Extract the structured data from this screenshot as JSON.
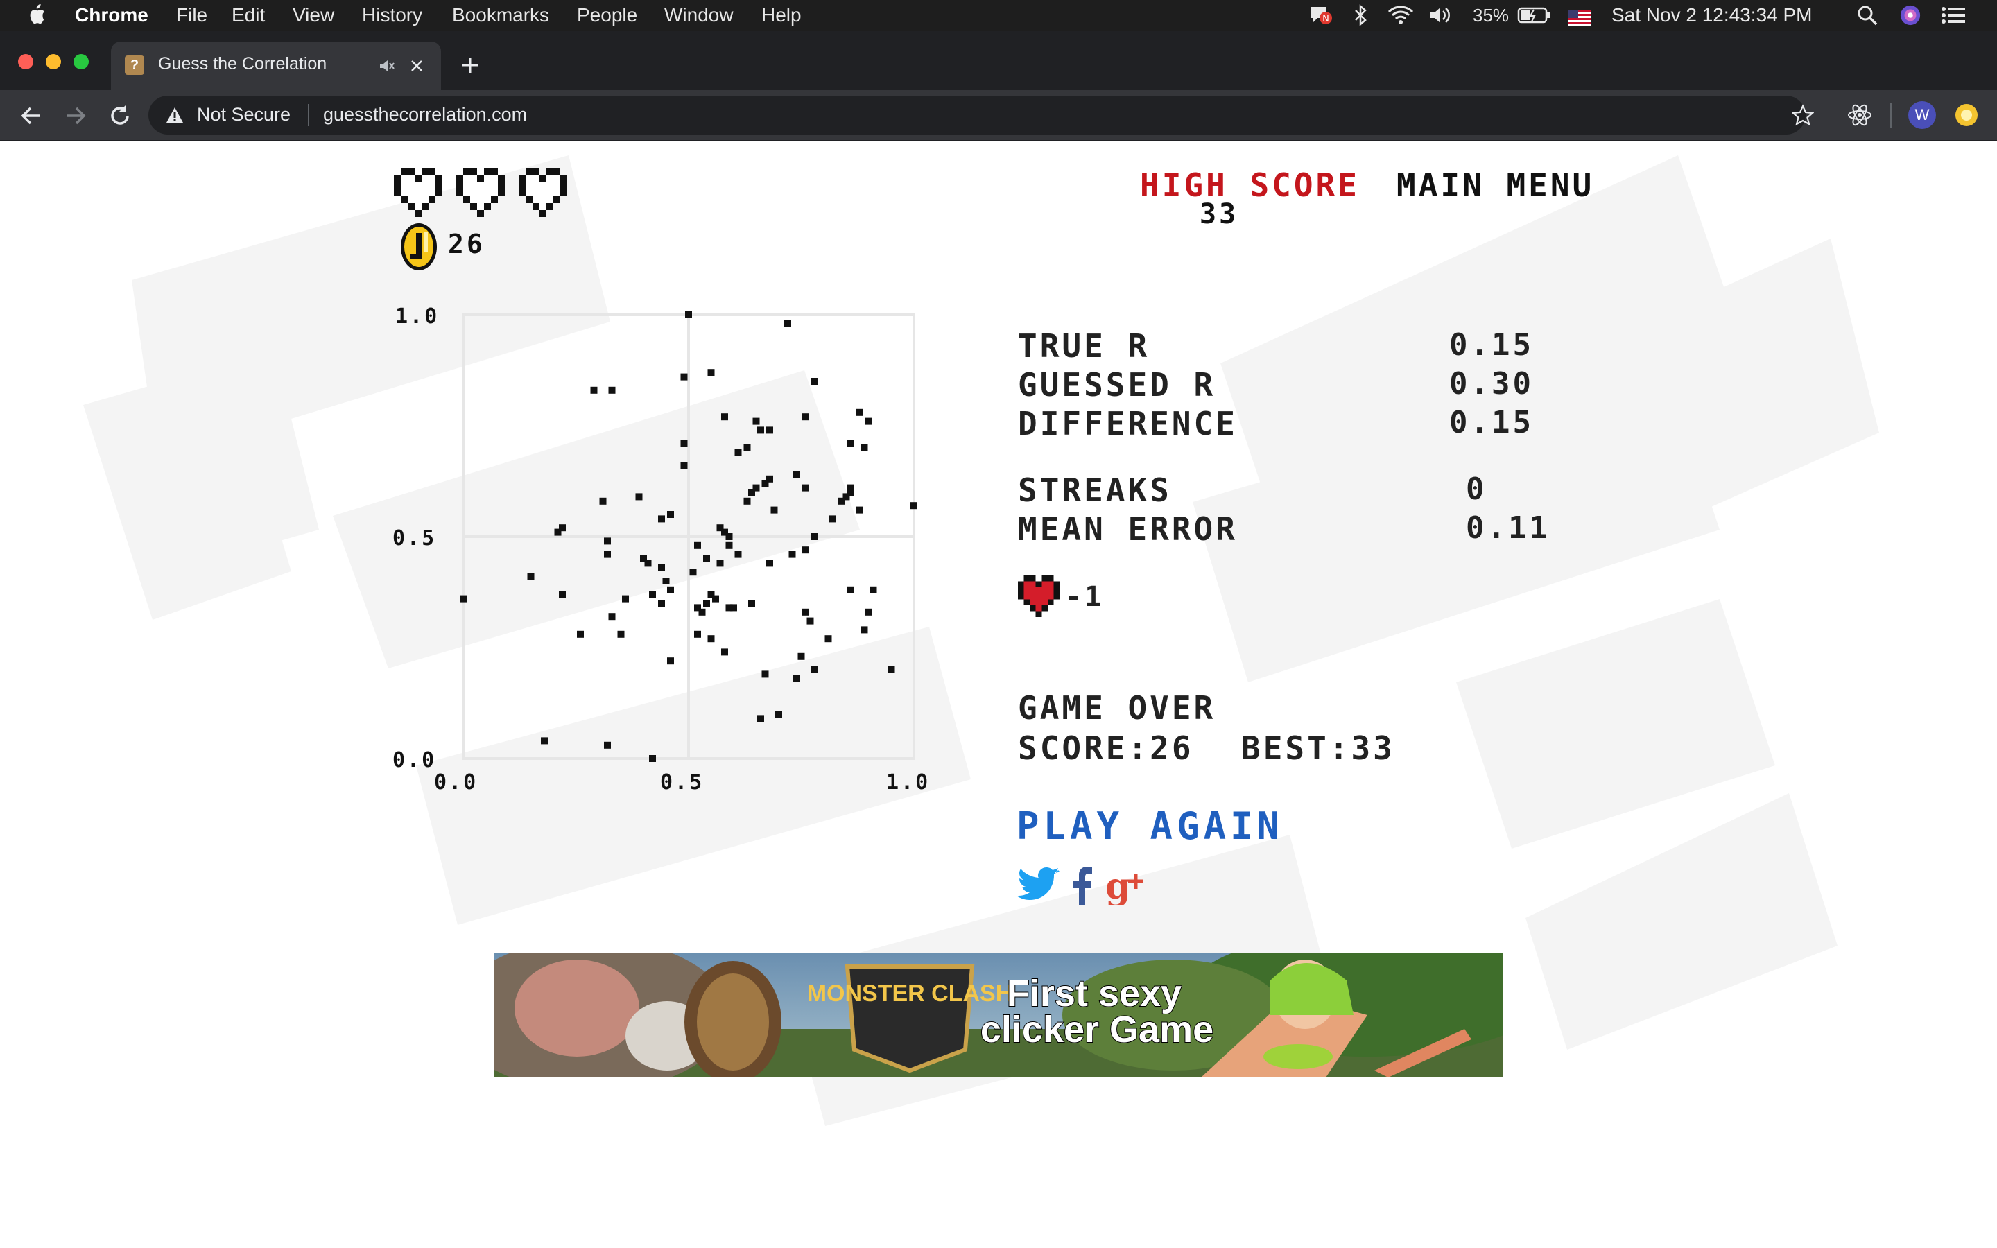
{
  "menubar": {
    "app_name": "Chrome",
    "items": [
      "File",
      "Edit",
      "View",
      "History",
      "Bookmarks",
      "People",
      "Window",
      "Help"
    ],
    "battery": "35%",
    "datetime": "Sat Nov 2  12:43:34 PM"
  },
  "browser": {
    "tab_title": "Guess the Correlation",
    "security_label": "Not Secure",
    "url": "guessthecorrelation.com",
    "profile_initial": "W"
  },
  "game": {
    "lives_remaining": 0,
    "lives_total": 3,
    "coins": "26",
    "high_score_label": "HIGH SCORE",
    "high_score_value": "33",
    "main_menu_label": "MAIN MENU",
    "stats": [
      {
        "label": "TRUE R",
        "value": "0.15"
      },
      {
        "label": "GUESSED R",
        "value": "0.30"
      },
      {
        "label": "DIFFERENCE",
        "value": "0.15"
      },
      {
        "label": "STREAKS",
        "value": "0"
      },
      {
        "label": "MEAN ERROR",
        "value": "0.11"
      }
    ],
    "life_change": "-1",
    "game_over_label": "GAME OVER",
    "score_label": "SCORE:26",
    "best_label": "BEST:33",
    "play_again_label": "PLAY AGAIN"
  },
  "colors": {
    "high_score_red": "#c4161c",
    "play_again_blue": "#1f5fbf",
    "twitter_blue": "#1da1f2",
    "facebook_blue": "#3b5998",
    "gplus_red": "#dd4b39",
    "heart_red": "#d41d2a",
    "coin_gold": "#f5c518"
  },
  "social": [
    "twitter-icon",
    "facebook-icon",
    "google-plus-icon"
  ],
  "ad": {
    "brand": "MONSTER CLASH",
    "line1": "First sexy",
    "line2": "clicker Game"
  },
  "chart_data": {
    "type": "scatter",
    "xlim": [
      0.0,
      1.0
    ],
    "ylim": [
      0.0,
      1.0
    ],
    "xticks": [
      "0.0",
      "0.5",
      "1.0"
    ],
    "yticks": [
      "0.0",
      "0.5",
      "1.0"
    ],
    "grid": true,
    "points": [
      [
        0.5,
        1.0
      ],
      [
        0.72,
        0.98
      ],
      [
        0.55,
        0.87
      ],
      [
        0.49,
        0.86
      ],
      [
        0.78,
        0.85
      ],
      [
        0.29,
        0.83
      ],
      [
        0.33,
        0.83
      ],
      [
        0.88,
        0.78
      ],
      [
        0.58,
        0.77
      ],
      [
        0.76,
        0.77
      ],
      [
        0.65,
        0.76
      ],
      [
        0.9,
        0.76
      ],
      [
        0.68,
        0.74
      ],
      [
        0.66,
        0.74
      ],
      [
        0.49,
        0.71
      ],
      [
        0.86,
        0.71
      ],
      [
        0.89,
        0.7
      ],
      [
        0.63,
        0.7
      ],
      [
        0.61,
        0.69
      ],
      [
        0.49,
        0.66
      ],
      [
        0.74,
        0.64
      ],
      [
        0.68,
        0.63
      ],
      [
        0.67,
        0.62
      ],
      [
        0.65,
        0.61
      ],
      [
        0.76,
        0.61
      ],
      [
        0.86,
        0.61
      ],
      [
        0.64,
        0.6
      ],
      [
        0.86,
        0.6
      ],
      [
        0.31,
        0.58
      ],
      [
        0.39,
        0.59
      ],
      [
        0.85,
        0.59
      ],
      [
        0.63,
        0.58
      ],
      [
        0.84,
        0.58
      ],
      [
        0.69,
        0.56
      ],
      [
        0.88,
        0.56
      ],
      [
        1.0,
        0.57
      ],
      [
        0.46,
        0.55
      ],
      [
        0.44,
        0.54
      ],
      [
        0.82,
        0.54
      ],
      [
        0.57,
        0.52
      ],
      [
        0.58,
        0.51
      ],
      [
        0.21,
        0.51
      ],
      [
        0.22,
        0.52
      ],
      [
        0.59,
        0.5
      ],
      [
        0.78,
        0.5
      ],
      [
        0.32,
        0.49
      ],
      [
        0.52,
        0.48
      ],
      [
        0.59,
        0.48
      ],
      [
        0.76,
        0.47
      ],
      [
        0.32,
        0.46
      ],
      [
        0.61,
        0.46
      ],
      [
        0.73,
        0.46
      ],
      [
        0.54,
        0.45
      ],
      [
        0.4,
        0.45
      ],
      [
        0.41,
        0.44
      ],
      [
        0.68,
        0.44
      ],
      [
        0.57,
        0.44
      ],
      [
        0.44,
        0.43
      ],
      [
        0.15,
        0.41
      ],
      [
        0.51,
        0.42
      ],
      [
        0.45,
        0.4
      ],
      [
        0.46,
        0.38
      ],
      [
        0.86,
        0.38
      ],
      [
        0.0,
        0.36
      ],
      [
        0.22,
        0.37
      ],
      [
        0.42,
        0.37
      ],
      [
        0.55,
        0.37
      ],
      [
        0.91,
        0.38
      ],
      [
        0.36,
        0.36
      ],
      [
        0.54,
        0.35
      ],
      [
        0.56,
        0.36
      ],
      [
        0.44,
        0.35
      ],
      [
        0.64,
        0.35
      ],
      [
        0.52,
        0.34
      ],
      [
        0.59,
        0.34
      ],
      [
        0.6,
        0.34
      ],
      [
        0.33,
        0.32
      ],
      [
        0.53,
        0.33
      ],
      [
        0.76,
        0.33
      ],
      [
        0.9,
        0.33
      ],
      [
        0.77,
        0.31
      ],
      [
        0.26,
        0.28
      ],
      [
        0.35,
        0.28
      ],
      [
        0.52,
        0.28
      ],
      [
        0.55,
        0.27
      ],
      [
        0.89,
        0.29
      ],
      [
        0.81,
        0.27
      ],
      [
        0.58,
        0.24
      ],
      [
        0.75,
        0.23
      ],
      [
        0.46,
        0.22
      ],
      [
        0.67,
        0.19
      ],
      [
        0.78,
        0.2
      ],
      [
        0.74,
        0.18
      ],
      [
        0.95,
        0.2
      ],
      [
        0.7,
        0.1
      ],
      [
        0.66,
        0.09
      ],
      [
        0.18,
        0.04
      ],
      [
        0.32,
        0.03
      ],
      [
        0.42,
        0.0
      ]
    ]
  }
}
